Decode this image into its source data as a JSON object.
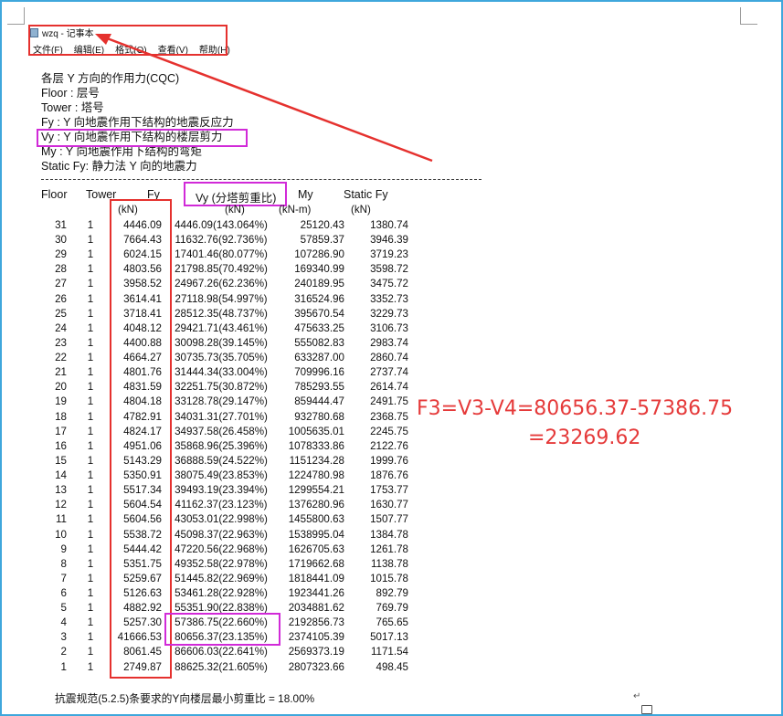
{
  "window": {
    "title": "wzq - 记事本",
    "menus": [
      "文件(F)",
      "编辑(E)",
      "格式(O)",
      "查看(V)",
      "帮助(H)"
    ]
  },
  "intro": {
    "heading": "各层 Y 方向的作用力(CQC)",
    "lines": [
      "Floor    : 层号",
      "Tower    : 塔号",
      "Fy       : Y 向地震作用下结构的地震反应力",
      "Vy       : Y 向地震作用下结构的楼层剪力",
      "My       : Y 向地震作用下结构的弯矩",
      "Static Fy: 静力法 Y 向的地震力"
    ]
  },
  "table": {
    "headers": [
      "Floor",
      "Tower",
      "Fy",
      "Vy (分塔剪重比)",
      "My",
      "Static Fy"
    ],
    "units": [
      "(kN)",
      "(kN)",
      "(kN-m)",
      "(kN)"
    ],
    "rows": [
      [
        "31",
        "1",
        "4446.09",
        "4446.09(143.064%)",
        "25120.43",
        "1380.74"
      ],
      [
        "30",
        "1",
        "7664.43",
        "11632.76(92.736%)",
        "57859.37",
        "3946.39"
      ],
      [
        "29",
        "1",
        "6024.15",
        "17401.46(80.077%)",
        "107286.90",
        "3719.23"
      ],
      [
        "28",
        "1",
        "4803.56",
        "21798.85(70.492%)",
        "169340.99",
        "3598.72"
      ],
      [
        "27",
        "1",
        "3958.52",
        "24967.26(62.236%)",
        "240189.95",
        "3475.72"
      ],
      [
        "26",
        "1",
        "3614.41",
        "27118.98(54.997%)",
        "316524.96",
        "3352.73"
      ],
      [
        "25",
        "1",
        "3718.41",
        "28512.35(48.737%)",
        "395670.54",
        "3229.73"
      ],
      [
        "24",
        "1",
        "4048.12",
        "29421.71(43.461%)",
        "475633.25",
        "3106.73"
      ],
      [
        "23",
        "1",
        "4400.88",
        "30098.28(39.145%)",
        "555082.83",
        "2983.74"
      ],
      [
        "22",
        "1",
        "4664.27",
        "30735.73(35.705%)",
        "633287.00",
        "2860.74"
      ],
      [
        "21",
        "1",
        "4801.76",
        "31444.34(33.004%)",
        "709996.16",
        "2737.74"
      ],
      [
        "20",
        "1",
        "4831.59",
        "32251.75(30.872%)",
        "785293.55",
        "2614.74"
      ],
      [
        "19",
        "1",
        "4804.18",
        "33128.78(29.147%)",
        "859444.47",
        "2491.75"
      ],
      [
        "18",
        "1",
        "4782.91",
        "34031.31(27.701%)",
        "932780.68",
        "2368.75"
      ],
      [
        "17",
        "1",
        "4824.17",
        "34937.58(26.458%)",
        "1005635.01",
        "2245.75"
      ],
      [
        "16",
        "1",
        "4951.06",
        "35868.96(25.396%)",
        "1078333.86",
        "2122.76"
      ],
      [
        "15",
        "1",
        "5143.29",
        "36888.59(24.522%)",
        "1151234.28",
        "1999.76"
      ],
      [
        "14",
        "1",
        "5350.91",
        "38075.49(23.853%)",
        "1224780.98",
        "1876.76"
      ],
      [
        "13",
        "1",
        "5517.34",
        "39493.19(23.394%)",
        "1299554.21",
        "1753.77"
      ],
      [
        "12",
        "1",
        "5604.54",
        "41162.37(23.123%)",
        "1376280.96",
        "1630.77"
      ],
      [
        "11",
        "1",
        "5604.56",
        "43053.01(22.998%)",
        "1455800.63",
        "1507.77"
      ],
      [
        "10",
        "1",
        "5538.72",
        "45098.37(22.963%)",
        "1538995.04",
        "1384.78"
      ],
      [
        "9",
        "1",
        "5444.42",
        "47220.56(22.968%)",
        "1626705.63",
        "1261.78"
      ],
      [
        "8",
        "1",
        "5351.75",
        "49352.58(22.978%)",
        "1719662.68",
        "1138.78"
      ],
      [
        "7",
        "1",
        "5259.67",
        "51445.82(22.969%)",
        "1818441.09",
        "1015.78"
      ],
      [
        "6",
        "1",
        "5126.63",
        "53461.28(22.928%)",
        "1923441.26",
        "892.79"
      ],
      [
        "5",
        "1",
        "4882.92",
        "55351.90(22.838%)",
        "2034881.62",
        "769.79"
      ],
      [
        "4",
        "1",
        "5257.30",
        "57386.75(22.660%)",
        "2192856.73",
        "765.65"
      ],
      [
        "3",
        "1",
        "41666.53",
        "80656.37(23.135%)",
        "2374105.39",
        "5017.13"
      ],
      [
        "2",
        "1",
        "8061.45",
        "86606.03(22.641%)",
        "2569373.19",
        "1171.54"
      ],
      [
        "1",
        "1",
        "2749.87",
        "88625.32(21.605%)",
        "2807323.66",
        "498.45"
      ]
    ]
  },
  "annotation": {
    "line1": "F3=V3-V4=80656.37-57386.75",
    "line2": "=23269.62",
    "color": "#e53a3a"
  },
  "footer": "抗震规范(5.2.5)条要求的Y向楼层最小剪重比 =   18.00%",
  "colors": {
    "red_box": "#e5312e",
    "pink_box": "#d12ad8",
    "frame": "#3fa7dc"
  }
}
